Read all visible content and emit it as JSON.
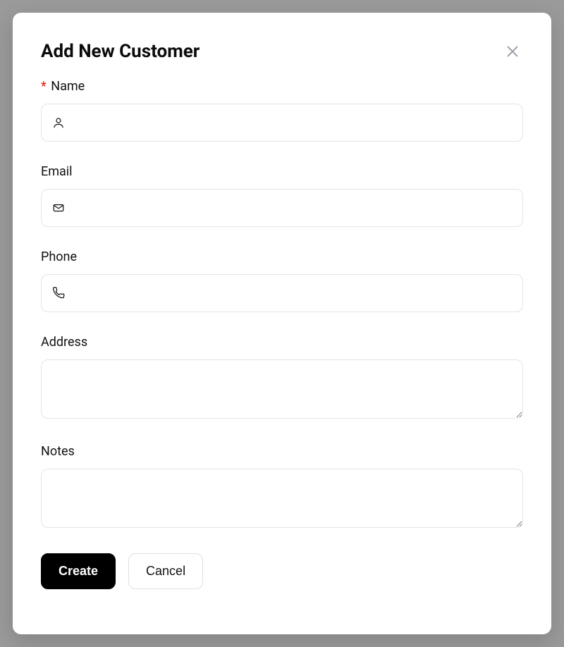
{
  "modal": {
    "title": "Add New Customer",
    "fields": {
      "name": {
        "label": "Name",
        "required": true,
        "value": "",
        "placeholder": ""
      },
      "email": {
        "label": "Email",
        "required": false,
        "value": "",
        "placeholder": ""
      },
      "phone": {
        "label": "Phone",
        "required": false,
        "value": "",
        "placeholder": ""
      },
      "address": {
        "label": "Address",
        "required": false,
        "value": "",
        "placeholder": ""
      },
      "notes": {
        "label": "Notes",
        "required": false,
        "value": "",
        "placeholder": ""
      }
    },
    "buttons": {
      "create": "Create",
      "cancel": "Cancel"
    },
    "required_marker": "*"
  }
}
